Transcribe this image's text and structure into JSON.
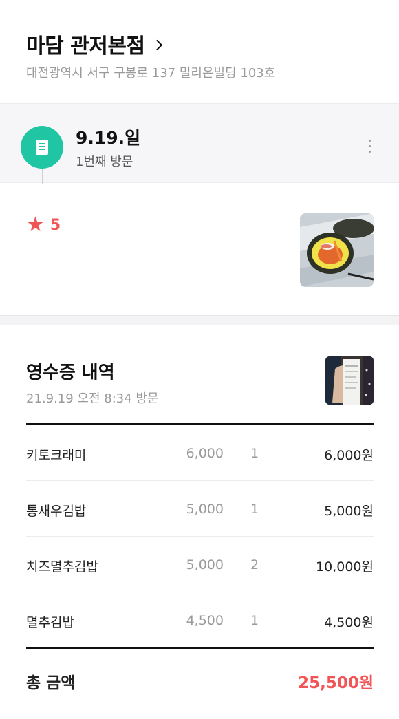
{
  "store": {
    "name": "마담 관저본점",
    "address": "대전광역시 서구 구봉로 137 밀리온빌딩 103호"
  },
  "visit": {
    "date": "9.19.일",
    "count": "1번째 방문",
    "icon": "receipt-icon",
    "accent": "#20c6a4"
  },
  "review": {
    "rating": "5",
    "star_color": "#f25555"
  },
  "receipt": {
    "title": "영수증 내역",
    "time": "21.9.19 오전 8:34 방문",
    "items": [
      {
        "name": "키토크래미",
        "price": "6,000",
        "qty": "1",
        "amount": "6,000원"
      },
      {
        "name": "통새우김밥",
        "price": "5,000",
        "qty": "1",
        "amount": "5,000원"
      },
      {
        "name": "치즈멸추김밥",
        "price": "5,000",
        "qty": "2",
        "amount": "10,000원"
      },
      {
        "name": "멸추김밥",
        "price": "4,500",
        "qty": "1",
        "amount": "4,500원"
      }
    ],
    "total_label": "총 금액",
    "total_amount": "25,500원"
  }
}
